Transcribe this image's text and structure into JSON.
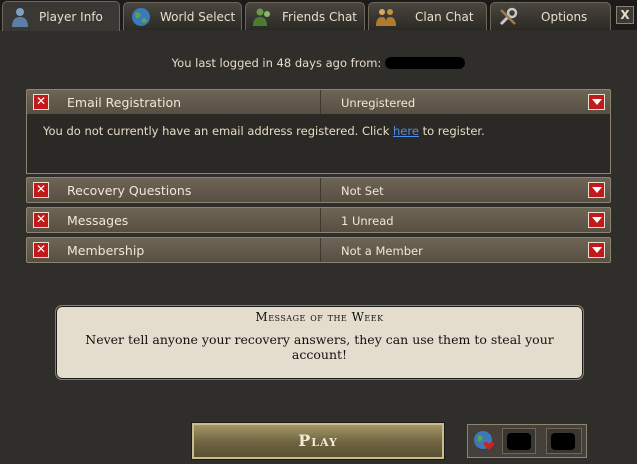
{
  "tabs": [
    {
      "label": "Player Info",
      "icon": "player-icon",
      "active": true
    },
    {
      "label": "World Select",
      "icon": "globe-icon"
    },
    {
      "label": "Friends Chat",
      "icon": "friends-icon"
    },
    {
      "label": "Clan Chat",
      "icon": "clan-icon"
    },
    {
      "label": "Options",
      "icon": "wrench-icon"
    }
  ],
  "close_label": "X",
  "last_login": {
    "text": "You last logged in 48 days ago from:"
  },
  "account_rows": [
    {
      "label": "Email Registration",
      "status": "Unregistered"
    },
    {
      "label": "Recovery Questions",
      "status": "Not Set"
    },
    {
      "label": "Messages",
      "status": "1 Unread"
    },
    {
      "label": "Membership",
      "status": "Not a Member"
    }
  ],
  "email_panel": {
    "text_before": "You do not currently have an email address registered. Click ",
    "link": "here",
    "text_after": " to register."
  },
  "motw": {
    "title": "Message of the Week",
    "text": "Never tell anyone your recovery answers, they can use them to steal your account!"
  },
  "play_label": "Play",
  "colors": {
    "accent_red": "#c21a1a",
    "link_blue": "#4f8ee8",
    "row_bg": "#6f6556",
    "panel_bg": "#2f2e2b"
  }
}
